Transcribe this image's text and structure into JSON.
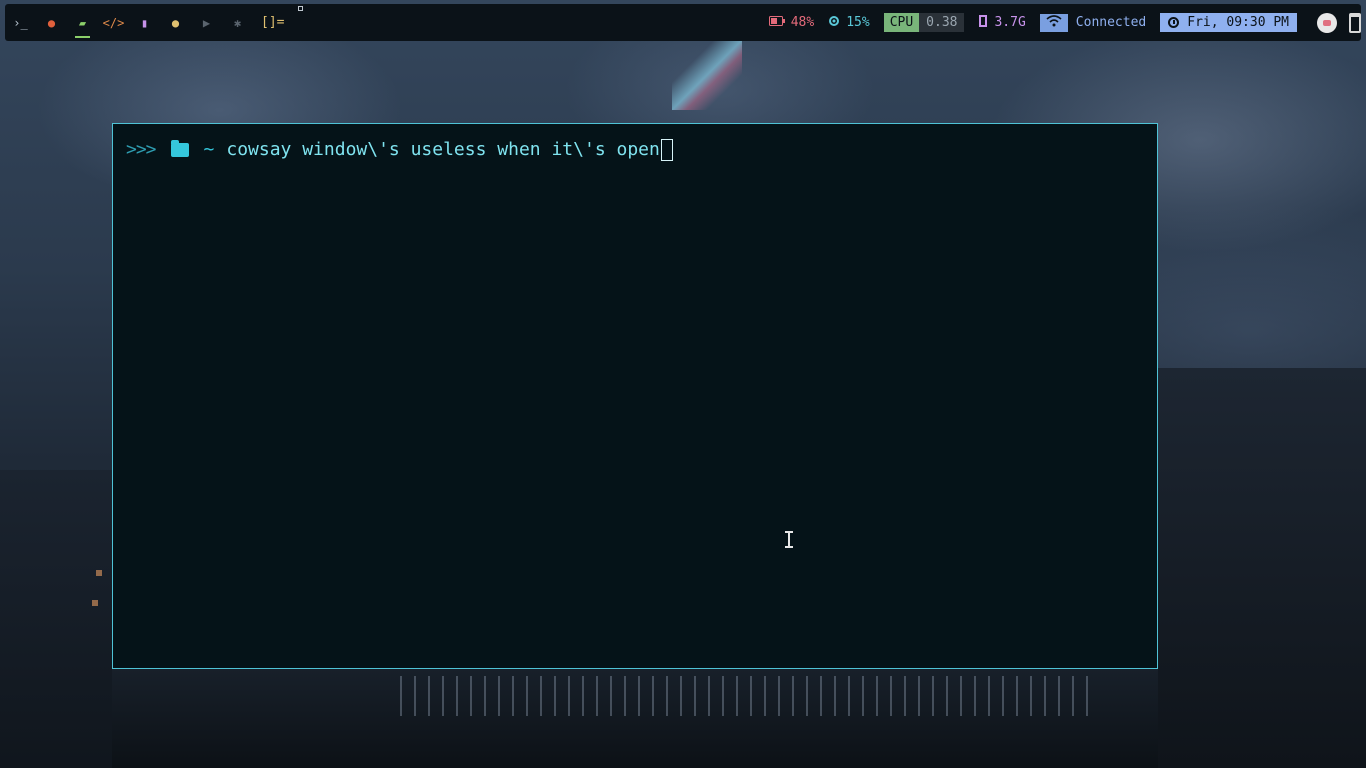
{
  "colors": {
    "accent_cyan": "#4fc3d6",
    "terminal_bg": "#051318",
    "battery": "#e36a7a",
    "cpu_temp": "#5ac8d8",
    "cpu_label_bg": "#79b57a",
    "memory": "#c792ea",
    "wifi_bg": "#7a9fe0",
    "clock_bg": "#8fb0ef"
  },
  "topbar": {
    "workspaces": [
      {
        "icon": "terminal-icon",
        "glyph": "›_",
        "color": "#b9c6d2"
      },
      {
        "icon": "firefox-icon",
        "glyph": "●",
        "color": "#e0603c"
      },
      {
        "icon": "folder-icon",
        "glyph": "▰",
        "color": "#8ccf6a",
        "active": true
      },
      {
        "icon": "code-icon",
        "glyph": "</>",
        "color": "#e08a4a"
      },
      {
        "icon": "book-icon",
        "glyph": "▮",
        "color": "#c792ea"
      },
      {
        "icon": "chat-icon",
        "glyph": "●",
        "color": "#e0c070"
      },
      {
        "icon": "youtube-icon",
        "glyph": "▶",
        "color": "#5a646e"
      },
      {
        "icon": "gear-icon",
        "glyph": "✱",
        "color": "#5a646e"
      }
    ],
    "layout_symbol": "[]=",
    "battery": {
      "icon": "battery-icon",
      "value": "48%"
    },
    "cpu_temp": {
      "icon": "cpu-temp-icon",
      "value": "15%"
    },
    "cpu": {
      "label": "CPU",
      "value": "0.38"
    },
    "memory": {
      "icon": "memory-icon",
      "value": "3.7G"
    },
    "network": {
      "icon": "wifi-icon",
      "status": "Connected"
    },
    "clock": {
      "icon": "clock-icon",
      "text": "Fri, 09:30 PM"
    }
  },
  "terminal": {
    "prompt_arrows": ">>>",
    "folder_icon": "folder-icon",
    "cwd": "~",
    "command": "cowsay window\\'s useless when it\\'s open"
  }
}
